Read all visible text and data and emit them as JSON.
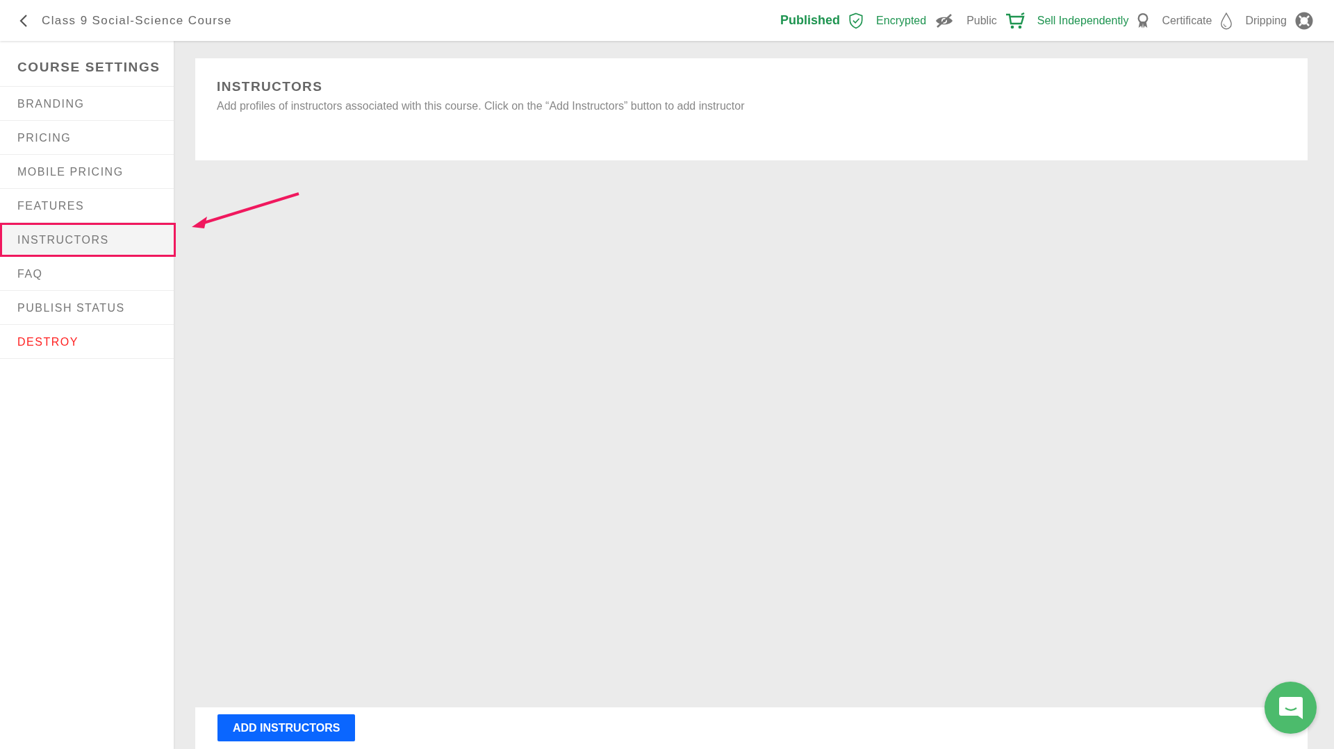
{
  "header": {
    "back_label": "Class 9 Social-Science Course",
    "status_items": [
      {
        "label": "Published",
        "active": true,
        "bold": true,
        "kind": "shield",
        "icon_active": true
      },
      {
        "label": "Encrypted",
        "active": true,
        "bold": false,
        "kind": "eye-slash",
        "icon_active": false
      },
      {
        "label": "Public",
        "active": false,
        "bold": false,
        "kind": "cart",
        "icon_active": true
      },
      {
        "label": "Sell Independently",
        "active": true,
        "bold": false,
        "kind": "ribbon",
        "icon_active": false
      },
      {
        "label": "Certificate",
        "active": false,
        "bold": false,
        "kind": "drop",
        "icon_active": false
      },
      {
        "label": "Dripping",
        "active": false,
        "bold": false,
        "kind": "lifebuoy",
        "icon_active": false
      }
    ]
  },
  "sidebar": {
    "title": "COURSE SETTINGS",
    "items": [
      {
        "label": "BRANDING",
        "selected": false,
        "kind": "normal"
      },
      {
        "label": "PRICING",
        "selected": false,
        "kind": "normal"
      },
      {
        "label": "MOBILE PRICING",
        "selected": false,
        "kind": "normal"
      },
      {
        "label": "FEATURES",
        "selected": false,
        "kind": "normal"
      },
      {
        "label": "INSTRUCTORS",
        "selected": true,
        "kind": "normal"
      },
      {
        "label": "FAQ",
        "selected": false,
        "kind": "normal"
      },
      {
        "label": "PUBLISH STATUS",
        "selected": false,
        "kind": "normal"
      },
      {
        "label": "DESTROY",
        "selected": false,
        "kind": "danger"
      }
    ]
  },
  "panel": {
    "title": "INSTRUCTORS",
    "description": "Add profiles of instructors associated with this course. Click on the “Add Instructors” button to add instructor"
  },
  "footer": {
    "button": "ADD INSTRUCTORS"
  }
}
